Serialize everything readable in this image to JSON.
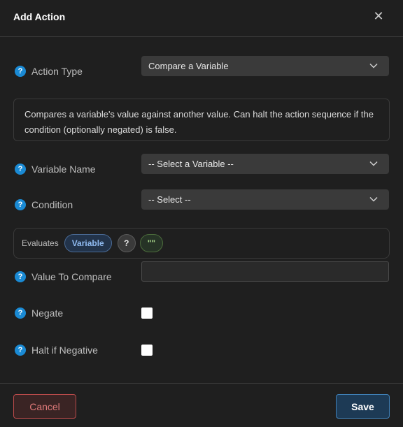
{
  "dialog": {
    "title": "Add Action",
    "close_icon": "close-icon"
  },
  "help_glyph": "?",
  "action_type": {
    "label": "Action Type",
    "value": "Compare a Variable"
  },
  "description": "Compares a variable's value against another value. Can halt the action sequence if the condition (optionally negated) is false.",
  "variable_name": {
    "label": "Variable Name",
    "value": "-- Select a Variable --"
  },
  "condition": {
    "label": "Condition",
    "value": "-- Select --"
  },
  "evaluates": {
    "label": "Evaluates",
    "variable_pill": "Variable",
    "operator_pill": "?",
    "value_pill": "\"\""
  },
  "value_to_compare": {
    "label": "Value To Compare",
    "value": "",
    "placeholder": ""
  },
  "negate": {
    "label": "Negate",
    "checked": false
  },
  "halt_if_negative": {
    "label": "Halt if Negative",
    "checked": false
  },
  "footer": {
    "cancel_label": "Cancel",
    "save_label": "Save"
  },
  "colors": {
    "background": "#1f1f1f",
    "help_icon": "#1a8ad4",
    "cancel_border": "#b84a4a",
    "save_border": "#3f7fb6"
  }
}
